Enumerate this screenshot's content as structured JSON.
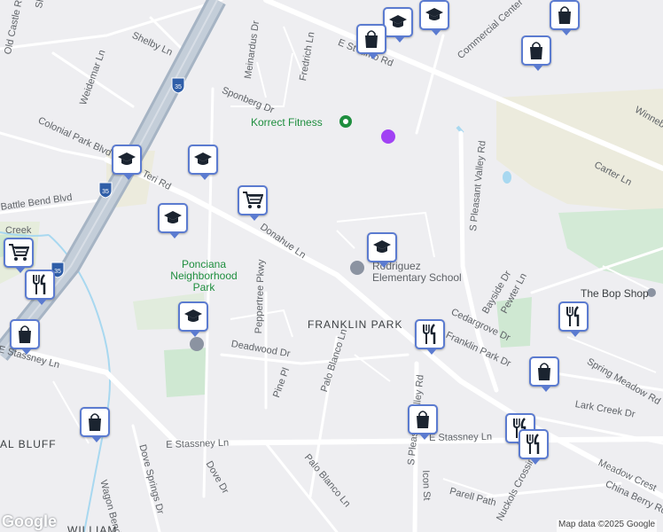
{
  "map": {
    "attribution": "Map data ©2025 Google",
    "logo": "Google",
    "highway_shield": "35",
    "areas": [
      "FRANKLIN PARK",
      "AL BLUFF",
      "WILLIAM"
    ],
    "parks": [
      "Ponciana Neighborhood Park"
    ],
    "places": [
      "Korrect Fitness",
      "The Bop Shop",
      "Rodriguez Elementary School"
    ],
    "streets": [
      "Sheraton Ave",
      "Old Castle Rd",
      "Shelby Ln",
      "Weidemar Ln",
      "Meinardus Dr",
      "Fredrich Ln",
      "E St Elmo Rd",
      "Commercial Center",
      "Sponberg Dr",
      "Colonial Park Blvd",
      "Teri Rd",
      "Carter Ln",
      "Battle Bend Blvd",
      "Donahue Ln",
      "S Pleasant Valley Rd",
      "Winnebago",
      "Peppertree Pkwy",
      "Bayside Dr",
      "Pewter Ln",
      "Cedargrove Dr",
      "Deadwood Dr",
      "Pine Pl",
      "Palo Blanco Ln",
      "Spring Meadow Rd",
      "Lark Creek Dr",
      "E Stassney Ln",
      "Meadow Crest",
      "Dove Springs Dr",
      "Dove Dr",
      "Wagon Bend",
      "Icon St",
      "Parell Path",
      "Nuckols Crossing",
      "China Berry Rd",
      "Franklin Park Dr",
      "Creek"
    ],
    "markers": [
      {
        "icon": "school-icon"
      },
      {
        "icon": "shopping-bag-icon"
      },
      {
        "icon": "school-icon"
      },
      {
        "icon": "shopping-bag-icon"
      },
      {
        "icon": "shopping-bag-icon"
      },
      {
        "icon": "school-icon"
      },
      {
        "icon": "school-icon"
      },
      {
        "icon": "shopping-cart-icon"
      },
      {
        "icon": "school-icon"
      },
      {
        "icon": "shopping-cart-icon"
      },
      {
        "icon": "restaurant-icon"
      },
      {
        "icon": "school-icon"
      },
      {
        "icon": "shopping-bag-icon"
      },
      {
        "icon": "restaurant-icon"
      },
      {
        "icon": "restaurant-icon"
      },
      {
        "icon": "shopping-bag-icon"
      },
      {
        "icon": "shopping-bag-icon"
      },
      {
        "icon": "shopping-bag-icon"
      },
      {
        "icon": "restaurant-icon"
      },
      {
        "icon": "restaurant-icon"
      },
      {
        "icon": "school-icon"
      }
    ]
  }
}
